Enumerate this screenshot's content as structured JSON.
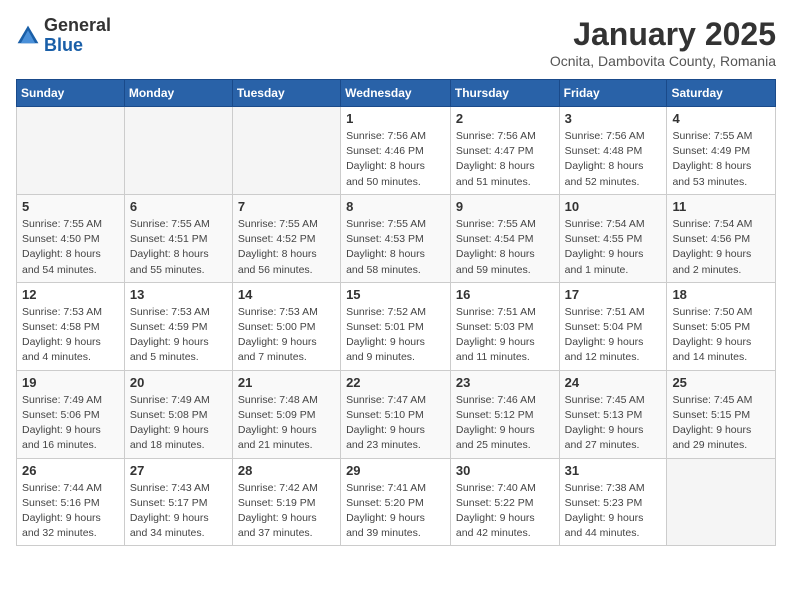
{
  "header": {
    "logo_general": "General",
    "logo_blue": "Blue",
    "title": "January 2025",
    "location": "Ocnita, Dambovita County, Romania"
  },
  "weekdays": [
    "Sunday",
    "Monday",
    "Tuesday",
    "Wednesday",
    "Thursday",
    "Friday",
    "Saturday"
  ],
  "weeks": [
    [
      {
        "day": "",
        "info": ""
      },
      {
        "day": "",
        "info": ""
      },
      {
        "day": "",
        "info": ""
      },
      {
        "day": "1",
        "info": "Sunrise: 7:56 AM\nSunset: 4:46 PM\nDaylight: 8 hours\nand 50 minutes."
      },
      {
        "day": "2",
        "info": "Sunrise: 7:56 AM\nSunset: 4:47 PM\nDaylight: 8 hours\nand 51 minutes."
      },
      {
        "day": "3",
        "info": "Sunrise: 7:56 AM\nSunset: 4:48 PM\nDaylight: 8 hours\nand 52 minutes."
      },
      {
        "day": "4",
        "info": "Sunrise: 7:55 AM\nSunset: 4:49 PM\nDaylight: 8 hours\nand 53 minutes."
      }
    ],
    [
      {
        "day": "5",
        "info": "Sunrise: 7:55 AM\nSunset: 4:50 PM\nDaylight: 8 hours\nand 54 minutes."
      },
      {
        "day": "6",
        "info": "Sunrise: 7:55 AM\nSunset: 4:51 PM\nDaylight: 8 hours\nand 55 minutes."
      },
      {
        "day": "7",
        "info": "Sunrise: 7:55 AM\nSunset: 4:52 PM\nDaylight: 8 hours\nand 56 minutes."
      },
      {
        "day": "8",
        "info": "Sunrise: 7:55 AM\nSunset: 4:53 PM\nDaylight: 8 hours\nand 58 minutes."
      },
      {
        "day": "9",
        "info": "Sunrise: 7:55 AM\nSunset: 4:54 PM\nDaylight: 8 hours\nand 59 minutes."
      },
      {
        "day": "10",
        "info": "Sunrise: 7:54 AM\nSunset: 4:55 PM\nDaylight: 9 hours\nand 1 minute."
      },
      {
        "day": "11",
        "info": "Sunrise: 7:54 AM\nSunset: 4:56 PM\nDaylight: 9 hours\nand 2 minutes."
      }
    ],
    [
      {
        "day": "12",
        "info": "Sunrise: 7:53 AM\nSunset: 4:58 PM\nDaylight: 9 hours\nand 4 minutes."
      },
      {
        "day": "13",
        "info": "Sunrise: 7:53 AM\nSunset: 4:59 PM\nDaylight: 9 hours\nand 5 minutes."
      },
      {
        "day": "14",
        "info": "Sunrise: 7:53 AM\nSunset: 5:00 PM\nDaylight: 9 hours\nand 7 minutes."
      },
      {
        "day": "15",
        "info": "Sunrise: 7:52 AM\nSunset: 5:01 PM\nDaylight: 9 hours\nand 9 minutes."
      },
      {
        "day": "16",
        "info": "Sunrise: 7:51 AM\nSunset: 5:03 PM\nDaylight: 9 hours\nand 11 minutes."
      },
      {
        "day": "17",
        "info": "Sunrise: 7:51 AM\nSunset: 5:04 PM\nDaylight: 9 hours\nand 12 minutes."
      },
      {
        "day": "18",
        "info": "Sunrise: 7:50 AM\nSunset: 5:05 PM\nDaylight: 9 hours\nand 14 minutes."
      }
    ],
    [
      {
        "day": "19",
        "info": "Sunrise: 7:49 AM\nSunset: 5:06 PM\nDaylight: 9 hours\nand 16 minutes."
      },
      {
        "day": "20",
        "info": "Sunrise: 7:49 AM\nSunset: 5:08 PM\nDaylight: 9 hours\nand 18 minutes."
      },
      {
        "day": "21",
        "info": "Sunrise: 7:48 AM\nSunset: 5:09 PM\nDaylight: 9 hours\nand 21 minutes."
      },
      {
        "day": "22",
        "info": "Sunrise: 7:47 AM\nSunset: 5:10 PM\nDaylight: 9 hours\nand 23 minutes."
      },
      {
        "day": "23",
        "info": "Sunrise: 7:46 AM\nSunset: 5:12 PM\nDaylight: 9 hours\nand 25 minutes."
      },
      {
        "day": "24",
        "info": "Sunrise: 7:45 AM\nSunset: 5:13 PM\nDaylight: 9 hours\nand 27 minutes."
      },
      {
        "day": "25",
        "info": "Sunrise: 7:45 AM\nSunset: 5:15 PM\nDaylight: 9 hours\nand 29 minutes."
      }
    ],
    [
      {
        "day": "26",
        "info": "Sunrise: 7:44 AM\nSunset: 5:16 PM\nDaylight: 9 hours\nand 32 minutes."
      },
      {
        "day": "27",
        "info": "Sunrise: 7:43 AM\nSunset: 5:17 PM\nDaylight: 9 hours\nand 34 minutes."
      },
      {
        "day": "28",
        "info": "Sunrise: 7:42 AM\nSunset: 5:19 PM\nDaylight: 9 hours\nand 37 minutes."
      },
      {
        "day": "29",
        "info": "Sunrise: 7:41 AM\nSunset: 5:20 PM\nDaylight: 9 hours\nand 39 minutes."
      },
      {
        "day": "30",
        "info": "Sunrise: 7:40 AM\nSunset: 5:22 PM\nDaylight: 9 hours\nand 42 minutes."
      },
      {
        "day": "31",
        "info": "Sunrise: 7:38 AM\nSunset: 5:23 PM\nDaylight: 9 hours\nand 44 minutes."
      },
      {
        "day": "",
        "info": ""
      }
    ]
  ]
}
